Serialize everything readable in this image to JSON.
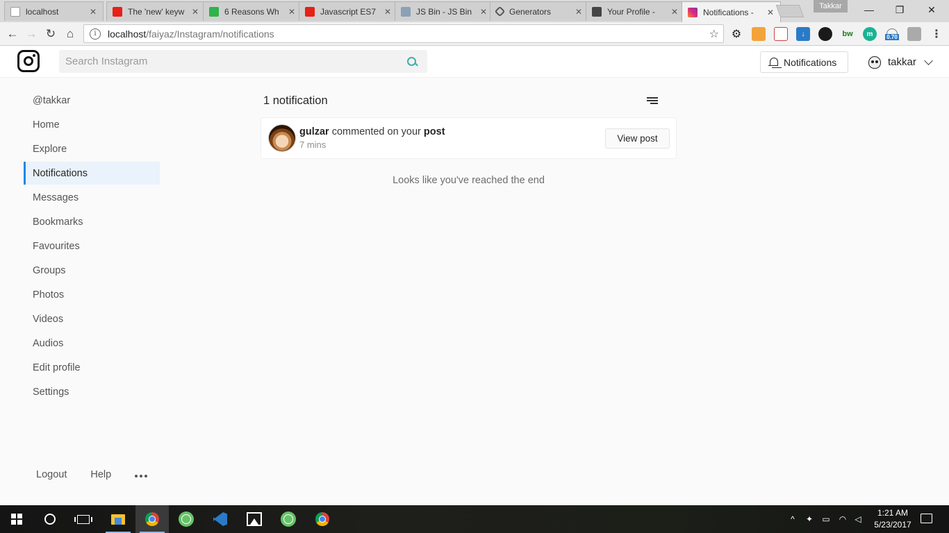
{
  "browser": {
    "tabs": [
      {
        "label": "localhost",
        "fav_color": "#e8e8e8"
      },
      {
        "label": "The 'new' keyw",
        "fav_color": "#e62117"
      },
      {
        "label": "6 Reasons Wh",
        "fav_color": "#2fb34a"
      },
      {
        "label": "Javascript ES7",
        "fav_color": "#e62117"
      },
      {
        "label": "JS Bin - JS Bin",
        "fav_color": "#8aa1b6"
      },
      {
        "label": "Generators",
        "fav_color": "#555555"
      },
      {
        "label": "Your Profile - ",
        "fav_color": "#444444"
      },
      {
        "label": "Notifications - ",
        "fav_color": "#c13584"
      }
    ],
    "profile_name": "Takkar",
    "url_host": "localhost",
    "url_path": "/faiyaz/Instagram/notifications",
    "info_icon": "i",
    "star_icon": "☆",
    "ext_badge": "0.70"
  },
  "header": {
    "search_placeholder": "Search Instagram",
    "notifications_label": "Notifications",
    "username": "takkar"
  },
  "sidebar": {
    "items": [
      {
        "label": "@takkar"
      },
      {
        "label": "Home"
      },
      {
        "label": "Explore"
      },
      {
        "label": "Notifications"
      },
      {
        "label": "Messages"
      },
      {
        "label": "Bookmarks"
      },
      {
        "label": "Favourites"
      },
      {
        "label": "Groups"
      },
      {
        "label": "Photos"
      },
      {
        "label": "Videos"
      },
      {
        "label": "Audios"
      },
      {
        "label": "Edit profile"
      },
      {
        "label": "Settings"
      }
    ],
    "active_item": "Notifications",
    "footer": {
      "logout": "Logout",
      "help": "Help"
    }
  },
  "main": {
    "count_label": "1 notification",
    "notifications": [
      {
        "user": "gulzar",
        "action": "commented on your",
        "target": "post",
        "time": "7 mins",
        "button": "View post"
      }
    ],
    "end_message": "Looks like you've reached the end"
  },
  "taskbar": {
    "time": "1:21 AM",
    "date": "5/23/2017"
  },
  "colors": {
    "accent_blue": "#1e88e5",
    "search_icon": "#3cb0a8",
    "page_bg": "#fafafa"
  }
}
